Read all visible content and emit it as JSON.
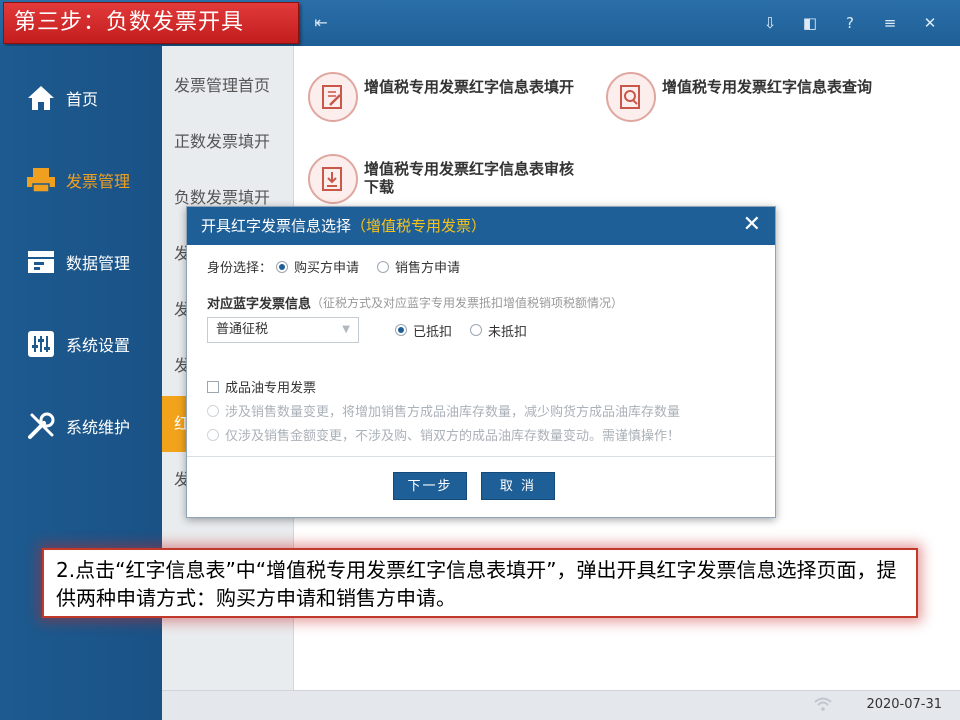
{
  "header": {
    "step_title": "第三步：负数发票开具",
    "collapse_icon": "collapse-menu-icon",
    "icons": [
      "download-icon",
      "bookmark-icon",
      "help-icon",
      "menu-icon",
      "close-icon"
    ],
    "icon_glyphs": [
      "⇩",
      "◧",
      "?",
      "≡",
      "✕"
    ]
  },
  "sidebar": {
    "items": [
      {
        "label": "首页",
        "icon": "home-icon"
      },
      {
        "label": "发票管理",
        "icon": "printer-icon",
        "active": true
      },
      {
        "label": "数据管理",
        "icon": "data-icon"
      },
      {
        "label": "系统设置",
        "icon": "sliders-icon"
      },
      {
        "label": "系统维护",
        "icon": "tools-icon"
      }
    ],
    "active_color": "#f0a020"
  },
  "submenu": {
    "items": [
      {
        "label": "发票管理首页"
      },
      {
        "label": "正数发票填开"
      },
      {
        "label": "负数发票填开"
      },
      {
        "label": "发"
      },
      {
        "label": "发"
      },
      {
        "label": "发"
      },
      {
        "label": "红",
        "active": true
      },
      {
        "label": "发"
      }
    ]
  },
  "content": {
    "cards": [
      {
        "label": "增值税专用发票红字信息表填开",
        "icon": "edit-document-icon"
      },
      {
        "label": "增值税专用发票红字信息表查询",
        "icon": "search-document-icon"
      },
      {
        "label": "增值税专用发票红字信息表审核下载",
        "icon": "download-document-icon"
      }
    ]
  },
  "dialog": {
    "title": "开具红字发票信息选择",
    "title_sub": "（增值税专用发票）",
    "identity_label": "身份选择：",
    "identity_options": [
      {
        "label": "购买方申请",
        "checked": true
      },
      {
        "label": "销售方申请",
        "checked": false
      }
    ],
    "blue_label": "对应蓝字发票信息",
    "blue_hint": "（征税方式及对应蓝字专用发票抵扣增值税销项税额情况）",
    "tax_mode_value": "普通征税",
    "deduct_options": [
      {
        "label": "已抵扣",
        "checked": true
      },
      {
        "label": "未抵扣",
        "checked": false
      }
    ],
    "oil_label": "成品油专用发票",
    "oil_options": [
      {
        "label": "涉及销售数量变更，将增加销售方成品油库存数量，减少购货方成品油库存数量"
      },
      {
        "label": "仅涉及销售金额变更，不涉及购、销双方的成品油库存数量变动。需谨慎操作！"
      }
    ],
    "next_label": "下一步",
    "cancel_label": "取 消"
  },
  "statusbar": {
    "date": "2020-07-31"
  },
  "callout": {
    "text": "2.点击“红字信息表”中“增值税专用发票红字信息表填开”，弹出开具红字发票信息选择页面，提供两种申请方式：购买方申请和销售方申请。"
  }
}
